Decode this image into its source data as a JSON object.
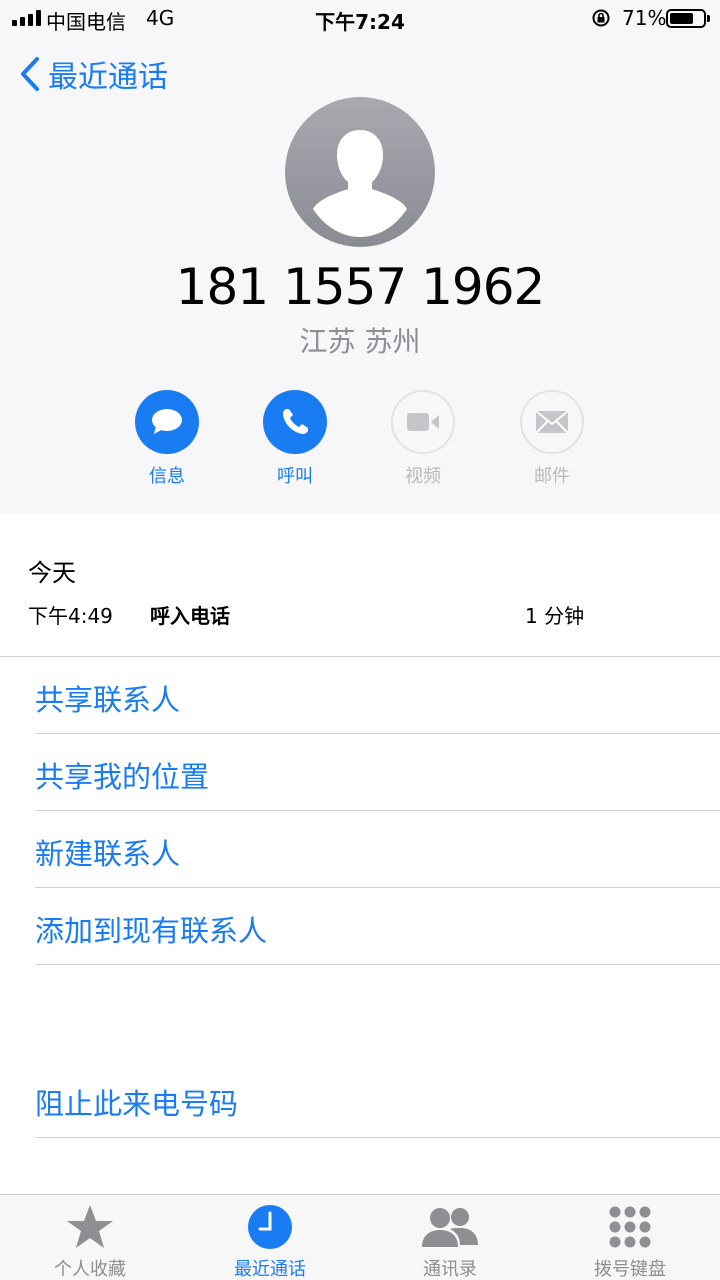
{
  "status_bar": {
    "carrier": "中国电信",
    "network": "4G",
    "time": "下午7:24",
    "battery_percent": "71%",
    "battery_level": 0.71
  },
  "nav": {
    "back_label": "最近通话"
  },
  "contact": {
    "phone_number": "181 1557 1962",
    "location": "江苏 苏州",
    "avatar_icon": "person-silhouette-icon"
  },
  "actions": [
    {
      "label": "信息",
      "icon": "message-icon",
      "enabled": true
    },
    {
      "label": "呼叫",
      "icon": "phone-icon",
      "enabled": true
    },
    {
      "label": "视频",
      "icon": "video-icon",
      "enabled": false
    },
    {
      "label": "邮件",
      "icon": "mail-icon",
      "enabled": false
    }
  ],
  "history": {
    "day": "今天",
    "time": "下午4:49",
    "type": "呼入电话",
    "duration": "1 分钟"
  },
  "options": {
    "share_contact": "共享联系人",
    "share_location": "共享我的位置",
    "new_contact": "新建联系人",
    "add_existing": "添加到现有联系人",
    "block": "阻止此来电号码"
  },
  "tabs": [
    {
      "label": "个人收藏",
      "icon": "star-icon",
      "selected": false
    },
    {
      "label": "最近通话",
      "icon": "clock-icon",
      "selected": true
    },
    {
      "label": "通讯录",
      "icon": "contacts-icon",
      "selected": false
    },
    {
      "label": "拨号键盘",
      "icon": "keypad-icon",
      "selected": false
    }
  ],
  "colors": {
    "accent": "#1a7cf2",
    "disabled": "#b9b9bd",
    "header_bg": "#f7f7f9"
  }
}
